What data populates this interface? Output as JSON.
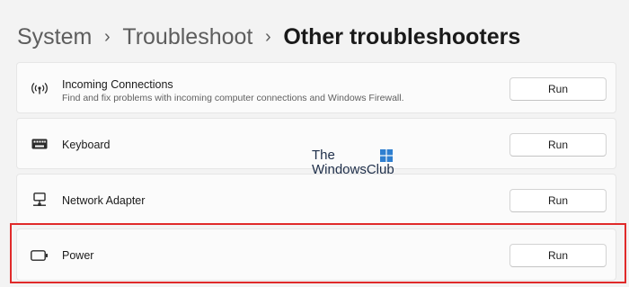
{
  "breadcrumb": {
    "items": [
      "System",
      "Troubleshoot"
    ],
    "current": "Other troubleshooters",
    "separator": "›"
  },
  "rows": [
    {
      "icon": "wireless-signal-icon",
      "title": "Incoming Connections",
      "description": "Find and fix problems with incoming computer connections and Windows Firewall.",
      "button": "Run"
    },
    {
      "icon": "keyboard-icon",
      "title": "Keyboard",
      "button": "Run"
    },
    {
      "icon": "network-adapter-icon",
      "title": "Network Adapter",
      "button": "Run"
    },
    {
      "icon": "battery-icon",
      "title": "Power",
      "button": "Run",
      "highlighted": true
    }
  ],
  "watermark": {
    "line1": "The",
    "line2": "WindowsClub",
    "logo": "windows-logo"
  },
  "colors": {
    "background": "#f3f3f3",
    "card": "#fbfbfb",
    "highlight": "#e02a2a",
    "watermark_logo": "#2f7fd0"
  }
}
